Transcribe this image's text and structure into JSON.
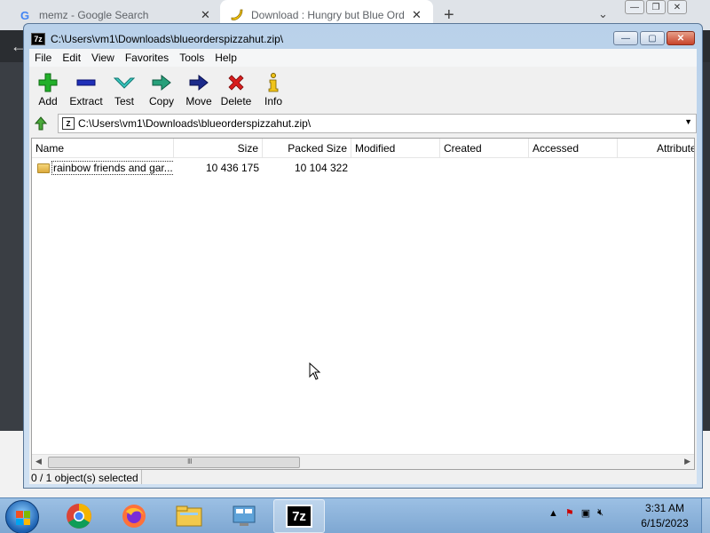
{
  "browser": {
    "tabs": [
      {
        "title": "memz - Google Search",
        "close": "✕"
      },
      {
        "title": "Download : Hungry but Blue Ord",
        "close": "✕"
      }
    ],
    "new_tab": "+",
    "tab_menu": "⌄"
  },
  "window": {
    "title": "C:\\Users\\vm1\\Downloads\\blueorderspizzahut.zip\\",
    "icon_text": "7z",
    "minimize": "—",
    "maximize": "▢",
    "close": "✕"
  },
  "menu": [
    "File",
    "Edit",
    "View",
    "Favorites",
    "Tools",
    "Help"
  ],
  "toolbar": [
    {
      "label": "Add",
      "icon": "add-icon"
    },
    {
      "label": "Extract",
      "icon": "extract-icon"
    },
    {
      "label": "Test",
      "icon": "test-icon"
    },
    {
      "label": "Copy",
      "icon": "copy-icon"
    },
    {
      "label": "Move",
      "icon": "move-icon"
    },
    {
      "label": "Delete",
      "icon": "delete-icon"
    },
    {
      "label": "Info",
      "icon": "info-icon"
    }
  ],
  "address": {
    "path": "C:\\Users\\vm1\\Downloads\\blueorderspizzahut.zip\\"
  },
  "columns": [
    "Name",
    "Size",
    "Packed Size",
    "Modified",
    "Created",
    "Accessed",
    "Attribute"
  ],
  "rows": [
    {
      "name": "rainbow friends and gar...",
      "size": "10 436 175",
      "packed": "10 104 322",
      "modified": "",
      "created": "",
      "accessed": "",
      "attributes": ""
    }
  ],
  "scroll": {
    "grip": "Ⅲ"
  },
  "status": {
    "selected": "0 / 1 object(s) selected"
  },
  "taskbar": {
    "time": "3:31 AM",
    "date": "6/15/2023",
    "app_7z_label": "7z"
  }
}
